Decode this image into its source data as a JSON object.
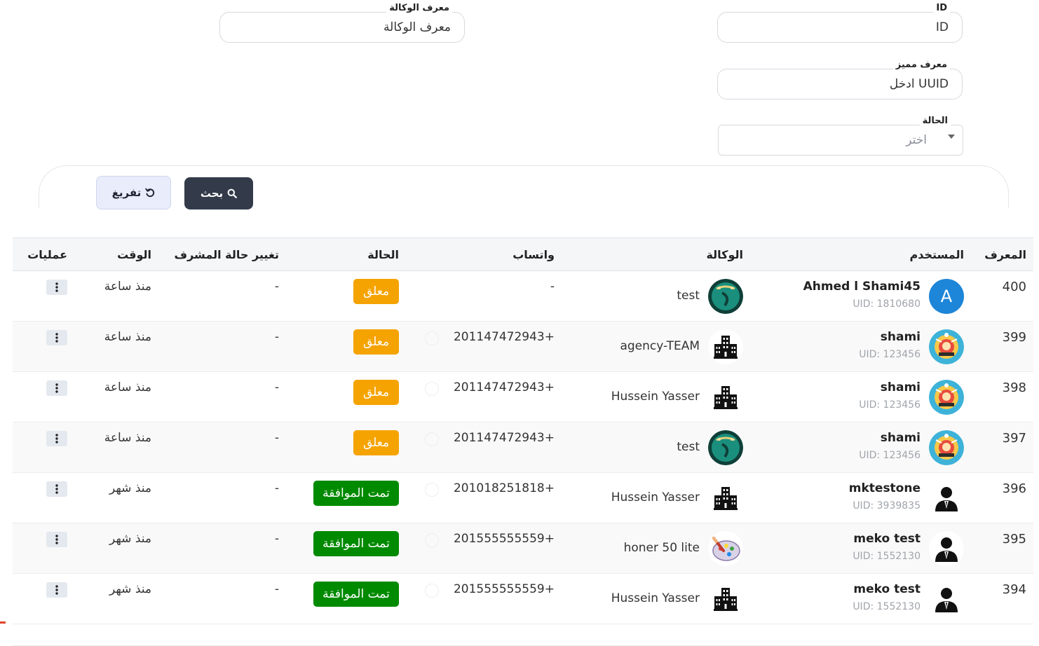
{
  "filters": {
    "agency_id": {
      "label": "معرف الوكالة",
      "value": "معرف الوكالة"
    },
    "id": {
      "label": "ID",
      "value": "ID"
    },
    "uuid": {
      "label": "معرف مميز",
      "value": "ادخل UUID"
    },
    "status": {
      "label": "الحالة",
      "placeholder": "اختر"
    }
  },
  "buttons": {
    "search": "بحث",
    "reset": "تفريغ"
  },
  "table": {
    "headers": {
      "id": "المعرف",
      "user": "المستخدم",
      "agency": "الوكالة",
      "whatsapp": "واتساب",
      "status": "الحالة",
      "supervisor": "تغيير حالة المشرف",
      "time": "الوقت",
      "actions": "عمليات"
    },
    "rows": [
      {
        "id": "400",
        "name": "Ahmed l Shami45",
        "uid": "UID: 1810680",
        "avatar": "letter",
        "avatar_letter": "A",
        "agency": "test",
        "agency_logo": "green-ring-icon",
        "whatsapp": "-",
        "status": "معلق",
        "status_type": "pending",
        "supervisor": "-",
        "time": "منذ ساعة"
      },
      {
        "id": "399",
        "name": "shami",
        "uid": "UID: 123456",
        "avatar": "badge",
        "agency": "agency-TEAM",
        "agency_logo": "buildings-icon",
        "whatsapp": "201147472943+",
        "status": "معلق",
        "status_type": "pending",
        "supervisor": "-",
        "time": "منذ ساعة"
      },
      {
        "id": "398",
        "name": "shami",
        "uid": "UID: 123456",
        "avatar": "badge",
        "agency": "Hussein Yasser",
        "agency_logo": "buildings-icon",
        "whatsapp": "201147472943+",
        "status": "معلق",
        "status_type": "pending",
        "supervisor": "-",
        "time": "منذ ساعة"
      },
      {
        "id": "397",
        "name": "shami",
        "uid": "UID: 123456",
        "avatar": "badge",
        "agency": "test",
        "agency_logo": "green-ring-icon",
        "whatsapp": "201147472943+",
        "status": "معلق",
        "status_type": "pending",
        "supervisor": "-",
        "time": "منذ ساعة"
      },
      {
        "id": "396",
        "name": "mktestone",
        "uid": "UID: 3939835",
        "avatar": "silhouette",
        "agency": "Hussein Yasser",
        "agency_logo": "buildings-icon",
        "whatsapp": "201018251818+",
        "status": "تمت الموافقة",
        "status_type": "approved",
        "supervisor": "-",
        "time": "منذ شهر"
      },
      {
        "id": "395",
        "name": "meko test",
        "uid": "UID: 1552130",
        "avatar": "silhouette",
        "agency": "honer 50 lite",
        "agency_logo": "palette-icon",
        "whatsapp": "201555555559+",
        "status": "تمت الموافقة",
        "status_type": "approved",
        "supervisor": "-",
        "time": "منذ شهر"
      },
      {
        "id": "394",
        "name": "meko test",
        "uid": "UID: 1552130",
        "avatar": "silhouette",
        "agency": "Hussein Yasser",
        "agency_logo": "buildings-icon",
        "whatsapp": "201555555559+",
        "status": "تمت الموافقة",
        "status_type": "approved",
        "supervisor": "-",
        "time": "منذ شهر"
      }
    ]
  },
  "colors": {
    "pending": "#f5a300",
    "approved": "#008a00",
    "search_btn": "#333b4a",
    "avatar_letter_bg": "#1d86d8"
  }
}
